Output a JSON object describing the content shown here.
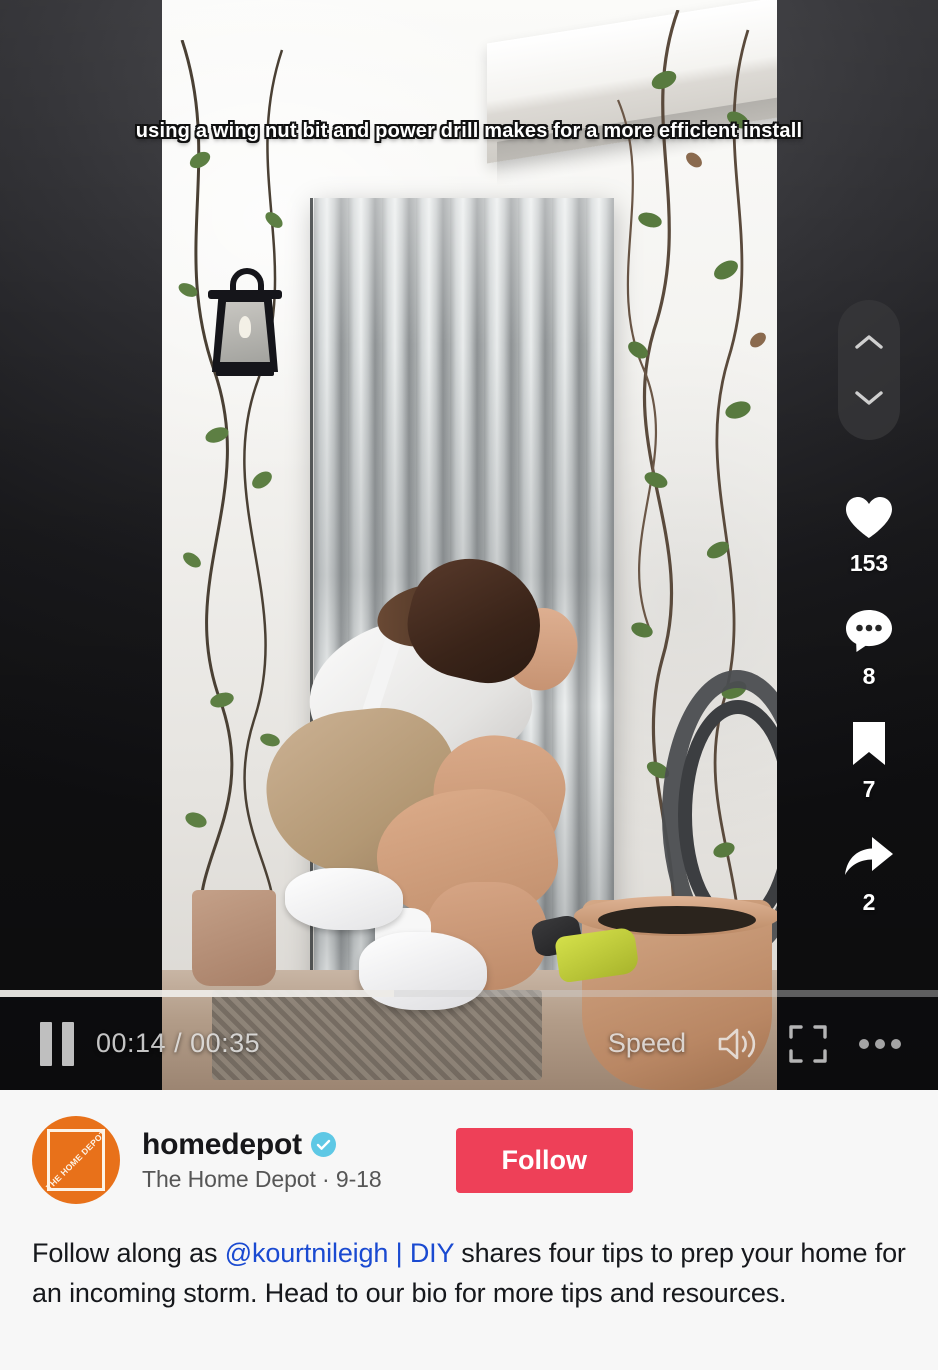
{
  "video": {
    "overlay_caption": "using a wing nut bit and power drill makes for a more efficient install",
    "scene_description": "Woman crouching installing corrugated metal hurricane storm panel over a doorway on a white stucco wall with climbing vines, black lantern sconce, garden hose reel and terracotta pots"
  },
  "player": {
    "pause_label": "pause",
    "current_time": "00:14",
    "time_separator": "/",
    "duration": "00:35",
    "time_display": "00:14 / 00:35",
    "progress_percent": 42,
    "speed_label": "Speed",
    "volume_icon": "volume-on-icon",
    "fullscreen_icon": "fullscreen-icon",
    "more_icon": "more-options-icon"
  },
  "rail": {
    "nav_up": "previous-video",
    "nav_down": "next-video",
    "actions": [
      {
        "icon": "heart-icon",
        "name": "like",
        "count": "153"
      },
      {
        "icon": "comment-icon",
        "name": "comment",
        "count": "8"
      },
      {
        "icon": "bookmark-icon",
        "name": "bookmark",
        "count": "7"
      },
      {
        "icon": "share-icon",
        "name": "share",
        "count": "2"
      }
    ]
  },
  "account": {
    "avatar_text": "THE HOME DEPOT",
    "username": "homedepot",
    "verified": true,
    "display_name_and_date": "The Home Depot · 9-18",
    "follow_label": "Follow"
  },
  "caption": {
    "before": "Follow along as ",
    "mention": "@kourtnileigh | DIY",
    "after": " shares four tips to prep your home for an incoming storm. Head to our bio for more tips and resources."
  },
  "colors": {
    "brand_orange": "#E8711A",
    "follow_red": "#EE4058",
    "verified_blue": "#5EC8E5",
    "mention_blue": "#1A4AD1",
    "info_background": "#F7F7F7"
  }
}
